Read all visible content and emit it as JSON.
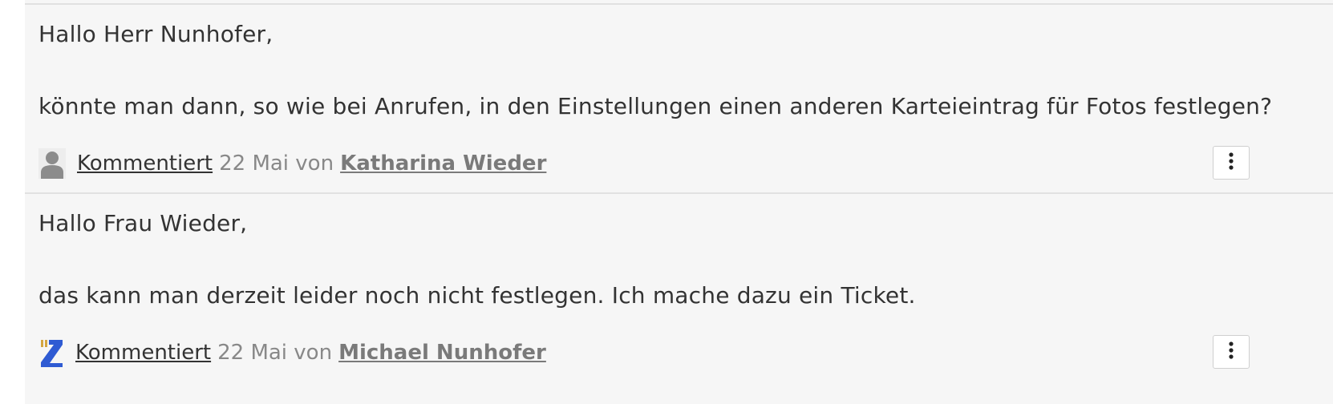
{
  "comments": [
    {
      "greeting": "Hallo Herr Nunhofer,",
      "body": "könnte man dann, so wie bei Anrufen, in den Einstellungen einen anderen Karteieintrag für Fotos festlegen?",
      "action_label": "Kommentiert",
      "date": "22 Mai",
      "by_label": "von",
      "author": "Katharina Wieder",
      "avatar_icon": "default-user-avatar-icon",
      "menu_icon": "vertical-ellipsis-icon"
    },
    {
      "greeting": "Hallo Frau Wieder,",
      "body": "das kann man derzeit leider noch nicht festlegen. Ich mache dazu ein Ticket.",
      "action_label": "Kommentiert",
      "date": "22 Mai",
      "by_label": "von",
      "author": "Michael Nunhofer",
      "avatar_icon": "z-logo-avatar-icon",
      "menu_icon": "vertical-ellipsis-icon"
    }
  ],
  "colors": {
    "background": "#f6f6f6",
    "divider": "#e1e1e1",
    "text": "#333333",
    "muted_text": "#888888",
    "author_link": "#7a7a7a",
    "logo_blue": "#2f5bd3",
    "logo_gold": "#d4a640"
  }
}
